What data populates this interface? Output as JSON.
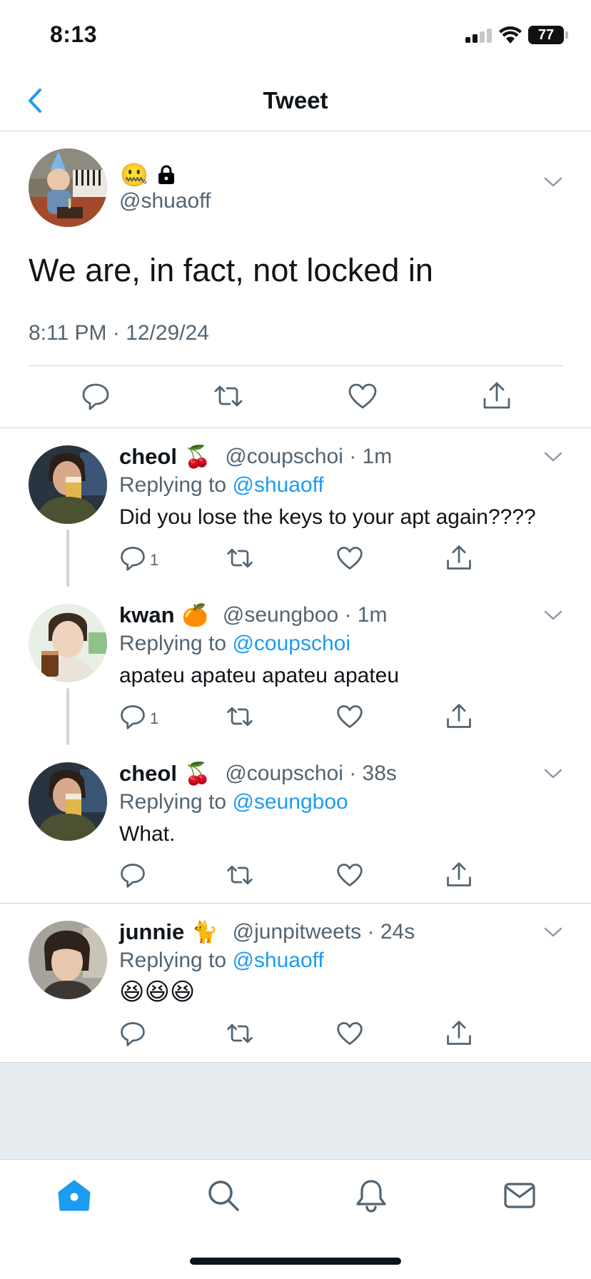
{
  "status_bar": {
    "time": "8:13",
    "battery": "77"
  },
  "header": {
    "title": "Tweet"
  },
  "main_tweet": {
    "name_emoji": "🤐",
    "handle": "@shuaoff",
    "text": "We are, in fact, not locked in",
    "timestamp": "8:11 PM · 12/29/24"
  },
  "replies": [
    {
      "name": "cheol",
      "emoji": "🍒",
      "handle": "@coupschoi · 1m",
      "replying_prefix": "Replying to ",
      "replying_to": "@shuaoff",
      "text": "Did you lose the keys to your apt again????",
      "reply_count": "1"
    },
    {
      "name": "kwan",
      "emoji": "🍊",
      "handle": "@seungboo · 1m",
      "replying_prefix": "Replying to ",
      "replying_to": "@coupschoi",
      "text": "apateu apateu apateu apateu",
      "reply_count": "1"
    },
    {
      "name": "cheol",
      "emoji": "🍒",
      "handle": "@coupschoi · 38s",
      "replying_prefix": "Replying to ",
      "replying_to": "@seungboo",
      "text": "What.",
      "reply_count": ""
    },
    {
      "name": "junnie",
      "emoji": "🐈",
      "handle": "@junpitweets · 24s",
      "replying_prefix": "Replying to ",
      "replying_to": "@shuaoff",
      "text": "😆😆😆",
      "reply_count": ""
    }
  ],
  "tabs": [
    {
      "icon": "home-icon"
    },
    {
      "icon": "search-icon"
    },
    {
      "icon": "bell-icon"
    },
    {
      "icon": "mail-icon"
    }
  ],
  "colors": {
    "accent": "#1d9bf0",
    "secondary_text": "#536471",
    "divider": "#cfd5da"
  }
}
